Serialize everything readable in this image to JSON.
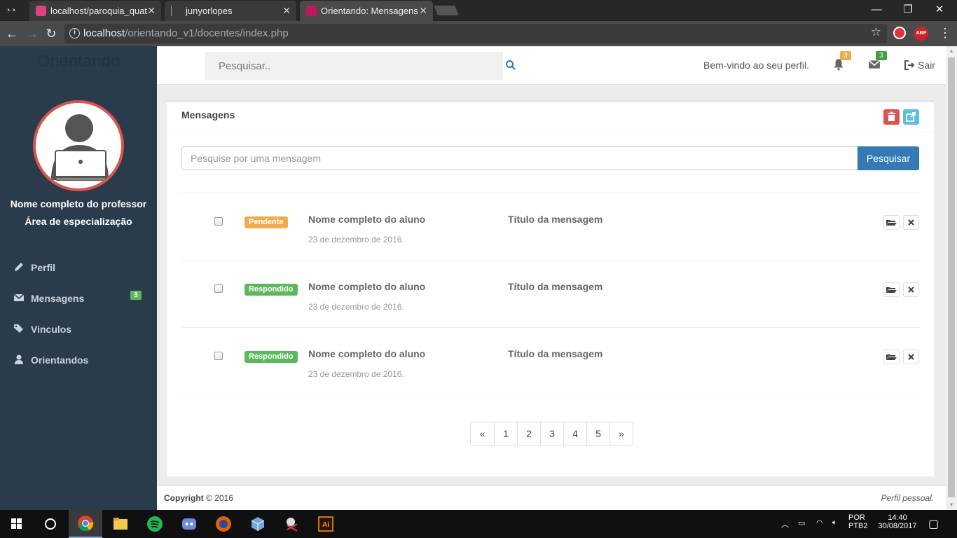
{
  "browser": {
    "tabs": [
      {
        "title": "localhost/paroquia_quat",
        "active": false
      },
      {
        "title": "junyorlopes",
        "active": false
      },
      {
        "title": "Orientando: Mensagens",
        "active": true
      }
    ],
    "url_host": "localhost",
    "url_path": "/orientando_v1/docentes/index.php"
  },
  "sidebar": {
    "brand": "Orientando",
    "profile_name": "Nome completo do professor",
    "profile_area": "Área de especialização",
    "items": [
      {
        "label": "Perfil",
        "icon": "pencil-icon"
      },
      {
        "label": "Mensagens",
        "icon": "envelope-icon",
        "badge": "3"
      },
      {
        "label": "Vinculos",
        "icon": "tags-icon"
      },
      {
        "label": "Orientandos",
        "icon": "user-icon"
      }
    ]
  },
  "header": {
    "search_placeholder": "Pesquisar..",
    "welcome": "Bem-vindo ao seu perfil.",
    "notifications_count": "3",
    "messages_count": "3",
    "logout_label": "Sair"
  },
  "panel": {
    "title": "Mensagens",
    "search_placeholder": "Pesquise por uma mensagem",
    "search_button": "Pesquisar",
    "messages": [
      {
        "status": "Pendente",
        "status_color": "#f0ad4e",
        "student": "Nome completo do aluno",
        "date": "23 de dezembro de 2016.",
        "title": "Título da mensagem"
      },
      {
        "status": "Respondido",
        "status_color": "#5cb85c",
        "student": "Nome completo do aluno",
        "date": "23 de dezembro de 2016.",
        "title": "Título da mensagem"
      },
      {
        "status": "Respondido",
        "status_color": "#5cb85c",
        "student": "Nome completo do aluno",
        "date": "23 de dezembro de 2016.",
        "title": "Título da mensagem"
      }
    ],
    "pagination": [
      "«",
      "1",
      "2",
      "3",
      "4",
      "5",
      "»"
    ]
  },
  "footer": {
    "copyright_label": "Copyright",
    "copyright_year": "© 2016",
    "right_text": "Perfil pessoal."
  },
  "taskbar": {
    "language": "POR",
    "layout": "PTB2",
    "time": "14:40",
    "date": "30/08/2017"
  },
  "colors": {
    "sidebar_bg": "#2a3b4c",
    "primary": "#337ab7",
    "danger": "#d9534f",
    "info": "#5bc0de",
    "warning": "#f0ad4e",
    "success": "#5cb85c"
  }
}
